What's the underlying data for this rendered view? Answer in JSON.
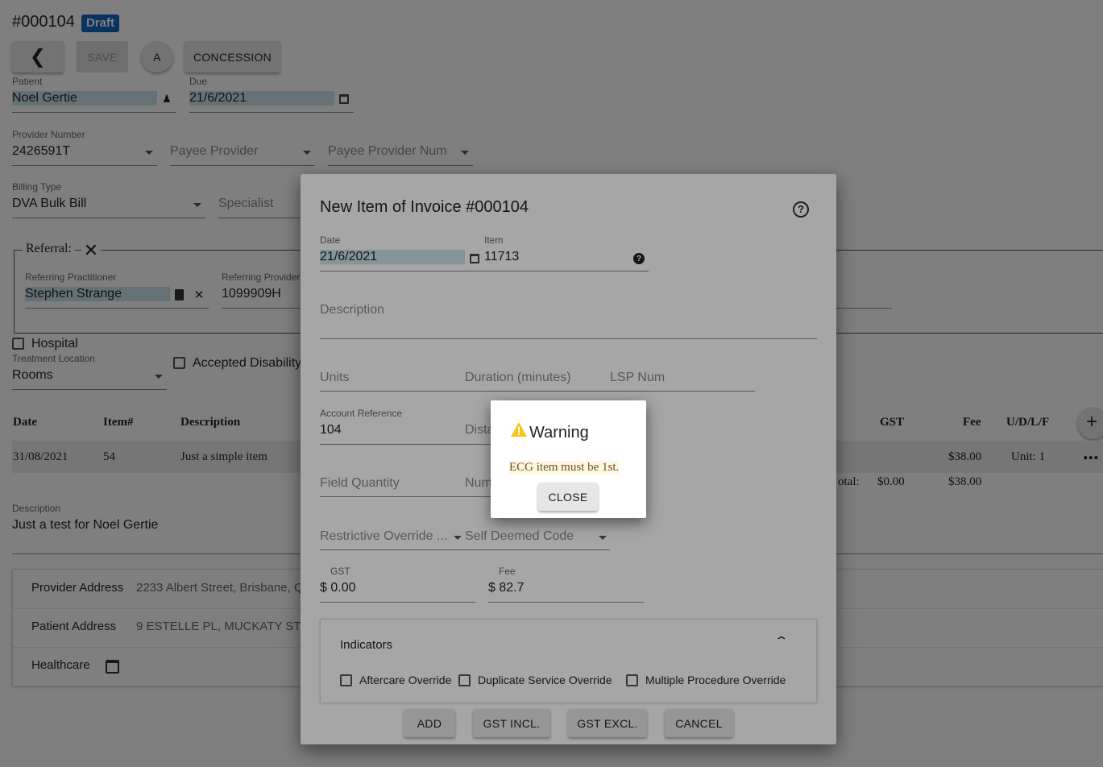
{
  "header": {
    "invoice_number": "#000104",
    "status_badge": "Draft"
  },
  "toolbar": {
    "save_label": "SAVE",
    "a_label": "A",
    "concession_label": "CONCESSION"
  },
  "patient": {
    "label": "Patient",
    "value": "Noel Gertie"
  },
  "due": {
    "label": "Due",
    "value": "21/6/2021"
  },
  "provider_number": {
    "label": "Provider Number",
    "value": "2426591T"
  },
  "payee_provider": {
    "placeholder": "Payee Provider"
  },
  "payee_provider_num": {
    "placeholder": "Payee Provider Num"
  },
  "billing_type": {
    "label": "Billing Type",
    "value": "DVA Bulk Bill"
  },
  "specialist": {
    "placeholder": "Specialist"
  },
  "referral": {
    "legend": "Referral:",
    "practitioner_label": "Referring Practitioner",
    "practitioner_value": "Stephen Strange",
    "provider_label": "Referring Provider",
    "provider_value": "1099909H"
  },
  "hospital": {
    "label": "Hospital"
  },
  "treatment_location": {
    "label": "Treatment Location",
    "value": "Rooms"
  },
  "accepted_disability": {
    "label": "Accepted Disability"
  },
  "table": {
    "headers": {
      "date": "Date",
      "item": "Item#",
      "description": "Description",
      "gst": "GST",
      "fee": "Fee",
      "udlf": "U/D/L/F"
    },
    "row": {
      "date": "31/08/2021",
      "item": "54",
      "description": "Just a simple item",
      "fee": "$38.00",
      "unit": "Unit: 1"
    },
    "total_label": "otal:",
    "total_gst": "$0.00",
    "total_fee": "$38.00"
  },
  "description_field": {
    "label": "Description",
    "value": "Just a test for Noel Gertie"
  },
  "addresses": {
    "provider_label": "Provider Address",
    "provider_value": "2233 Albert Street, Brisbane, Q",
    "patient_label": "Patient Address",
    "patient_value": "9 ESTELLE PL, MUCKATY STATI",
    "healthcare_label": "Healthcare"
  },
  "dialog": {
    "title": "New Item of Invoice #000104",
    "date_label": "Date",
    "date_value": "21/6/2021",
    "item_label": "Item",
    "item_value": "11713",
    "description_placeholder": "Description",
    "units_placeholder": "Units",
    "duration_placeholder": "Duration (minutes)",
    "lsp_placeholder": "LSP Num",
    "account_ref_label": "Account Reference",
    "account_ref_value": "104",
    "distance_placeholder": "Dista",
    "field_quantity_placeholder": "Field Quantity",
    "num_placeholder": "Num",
    "restrictive_placeholder": "Restrictive Override ...",
    "self_deemed_placeholder": "Self Deemed Code",
    "gst_label": "GST",
    "gst_value": "$ 0.00",
    "fee_label": "Fee",
    "fee_value": "$ 82.7",
    "indicators_title": "Indicators",
    "aftercare_label": "Aftercare Override",
    "duplicate_label": "Duplicate Service Override",
    "multiple_label": "Multiple Procedure Override",
    "add_label": "ADD",
    "gst_incl_label": "GST INCL.",
    "gst_excl_label": "GST EXCL.",
    "cancel_label": "CANCEL"
  },
  "warning": {
    "title": "Warning",
    "message": "ECG item must be 1st.",
    "close_label": "CLOSE"
  },
  "colors": {
    "badge": "#1565c0",
    "highlight": "#c9e4ef",
    "warning_icon": "#f5c518",
    "warning_text_bg": "#fdf6e3"
  }
}
